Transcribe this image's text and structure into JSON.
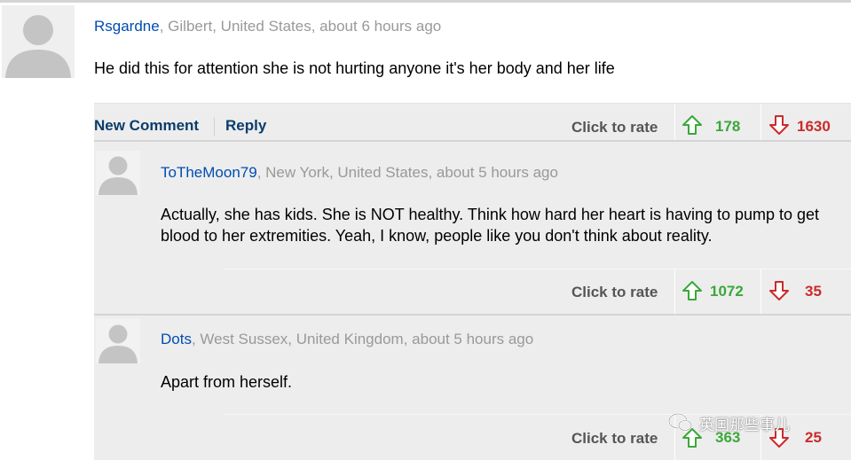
{
  "comments": [
    {
      "username": "Rsgardne",
      "location": ", Gilbert, United States, about 6 hours ago",
      "text": "He did this for attention she is not hurting anyone it's her body and her life",
      "new_comment_label": "New Comment",
      "reply_label": "Reply",
      "rate_label": "Click to rate",
      "up_votes": "178",
      "down_votes": "1630"
    },
    {
      "username": "ToTheMoon79",
      "location": ", New York, United States, about 5 hours ago",
      "text": "Actually, she has kids. She is NOT healthy. Think how hard her heart is having to pump to get blood to her extremities. Yeah, I know, people like you don't think about reality.",
      "rate_label": "Click to rate",
      "up_votes": "1072",
      "down_votes": "35"
    },
    {
      "username": "Dots",
      "location": ", West Sussex, United Kingdom, about 5 hours ago",
      "text": "Apart from herself.",
      "rate_label": "Click to rate",
      "up_votes": "363",
      "down_votes": "25"
    }
  ],
  "watermark": "英国那些事儿",
  "colors": {
    "username": "#004db3",
    "up": "#3aa83a",
    "down": "#cc2a2a",
    "reply_bg": "#ededed"
  }
}
